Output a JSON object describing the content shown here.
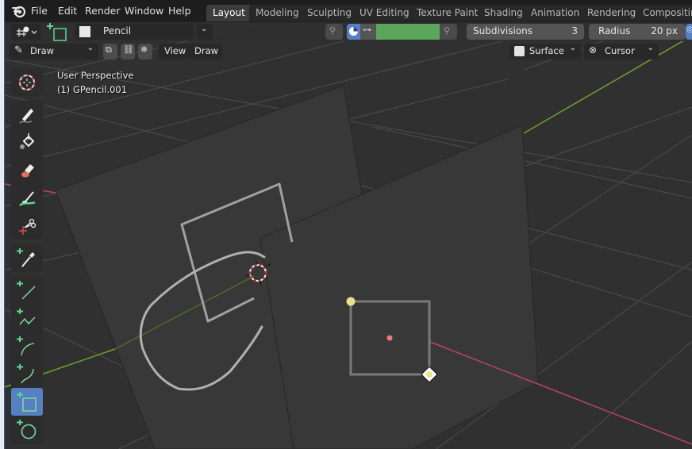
{
  "topbar": {
    "menus": [
      "File",
      "Edit",
      "Render",
      "Window",
      "Help"
    ],
    "workspaces": [
      {
        "label": "Layout",
        "active": true
      },
      {
        "label": "Modeling",
        "active": false
      },
      {
        "label": "Sculpting",
        "active": false
      },
      {
        "label": "UV Editing",
        "active": false
      },
      {
        "label": "Texture Paint",
        "active": false
      },
      {
        "label": "Shading",
        "active": false
      },
      {
        "label": "Animation",
        "active": false
      },
      {
        "label": "Rendering",
        "active": false
      },
      {
        "label": "Compositing",
        "active": false
      }
    ]
  },
  "header": {
    "brush_name": "Pencil",
    "color_swatch": "#5ca65c",
    "subdivisions_label": "Subdivisions",
    "subdivisions_value": "3",
    "radius_label": "Radius",
    "radius_value": "20 px"
  },
  "toolsettings": {
    "mode": "Draw",
    "view_menu": "View",
    "draw_menu": "Draw",
    "placement": "Surface",
    "origin": "Cursor"
  },
  "viewport": {
    "perspective_label": "User Perspective",
    "object_label": "(1) GPencil.001"
  },
  "toolbar": {
    "tools": [
      {
        "name": "cursor",
        "active": false
      },
      {
        "name": "draw",
        "active": false
      },
      {
        "name": "fill",
        "active": false
      },
      {
        "name": "erase",
        "active": false
      },
      {
        "name": "tint",
        "active": false
      },
      {
        "name": "cutter",
        "active": false
      },
      {
        "name": "eyedropper",
        "active": false
      },
      {
        "name": "line",
        "active": false
      },
      {
        "name": "polyline",
        "active": false
      },
      {
        "name": "arc",
        "active": false
      },
      {
        "name": "curve",
        "active": false
      },
      {
        "name": "box",
        "active": true
      },
      {
        "name": "circle",
        "active": false
      }
    ]
  },
  "colors": {
    "accent": "#5680c2",
    "x_axis": "#b8485a",
    "y_axis": "#72a12e",
    "tool_green": "#7bd6a0",
    "stroke_gray": "#a8a8a8"
  }
}
